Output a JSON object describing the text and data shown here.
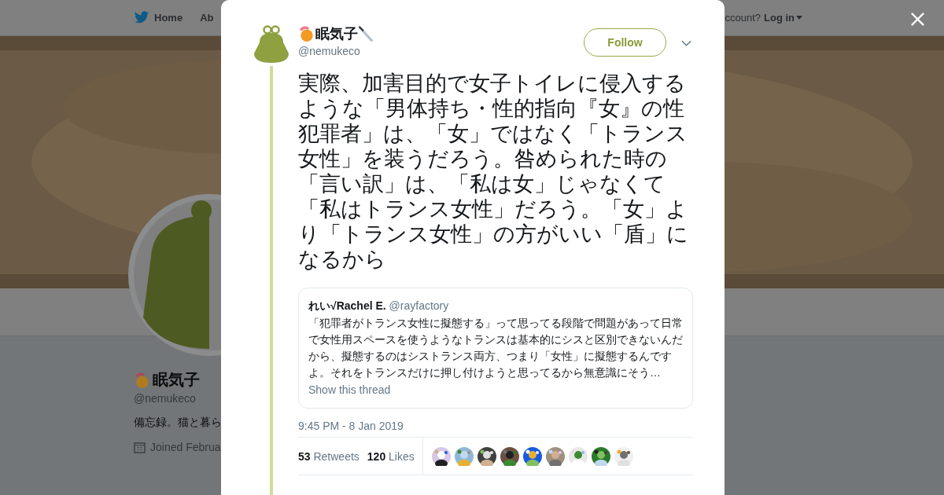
{
  "background": {
    "nav": [
      {
        "label": "Home",
        "kind": "home"
      },
      {
        "label": "Ab",
        "kind": "plain"
      }
    ],
    "account_prompt": "ccount?",
    "login": "Log in",
    "profile": {
      "name": "眠気子",
      "handle": "@nemukeco",
      "bio": "備忘録。猫と暮ら",
      "joined": "Joined Februa"
    }
  },
  "tweet": {
    "name": "眠気子",
    "handle": "@nemukeco",
    "follow": "Follow",
    "text": "実際、加害目的で女子トイレに侵入するような「男体持ち・性的指向『女』の性犯罪者」は、「女」ではなく「トランス女性」を装うだろう。咎められた時の「言い訳」は、「私は女」じゃなくて「私はトランス女性」だろう。「女」より「トランス女性」の方がいい「盾」になるから",
    "quote": {
      "name": "れい√Rachel E.",
      "handle": "@rayfactory",
      "text": "「犯罪者がトランス女性に擬態する」って思ってる段階で問題があって日常で女性用スペースを使うようなトランスは基本的にシスと区別できないんだから、擬態するのはシストランス両方、つまり「女性」に擬態するんですよ。それをトランスだけに押し付けようと思ってるから無意識にそう…",
      "link": "Show this thread"
    },
    "time": "9:45 PM - 8 Jan 2019",
    "stats": [
      {
        "count": "53",
        "label": "Retweets"
      },
      {
        "count": "120",
        "label": "Likes"
      }
    ]
  }
}
